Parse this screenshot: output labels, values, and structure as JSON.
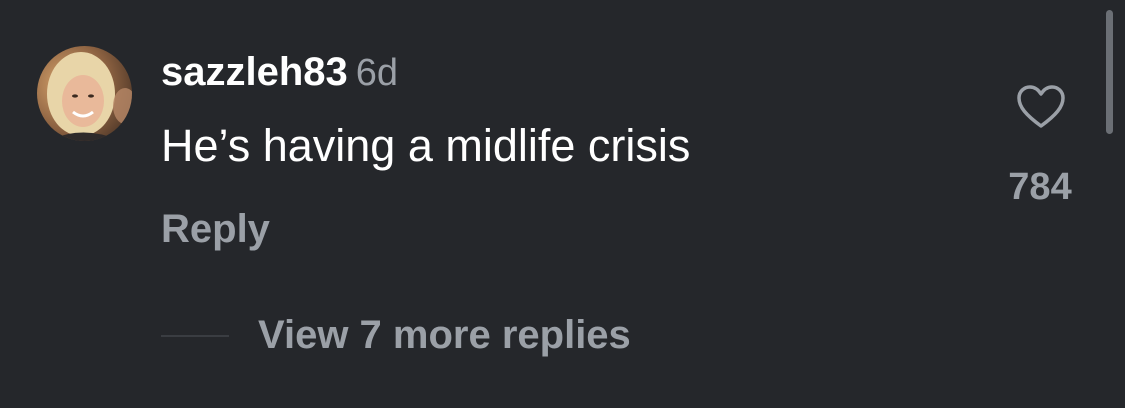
{
  "comment": {
    "username": "sazzleh83",
    "time_ago": "6d",
    "text": "He’s having a midlife crisis",
    "reply_label": "Reply",
    "like_count": "784"
  },
  "replies": {
    "view_more_label": "View 7 more replies"
  },
  "icons": {
    "like": "heart-icon",
    "avatar": "user-avatar-photo"
  },
  "colors": {
    "background": "#25272b",
    "primary_text": "#ffffff",
    "secondary_text": "#9ba0a7"
  }
}
